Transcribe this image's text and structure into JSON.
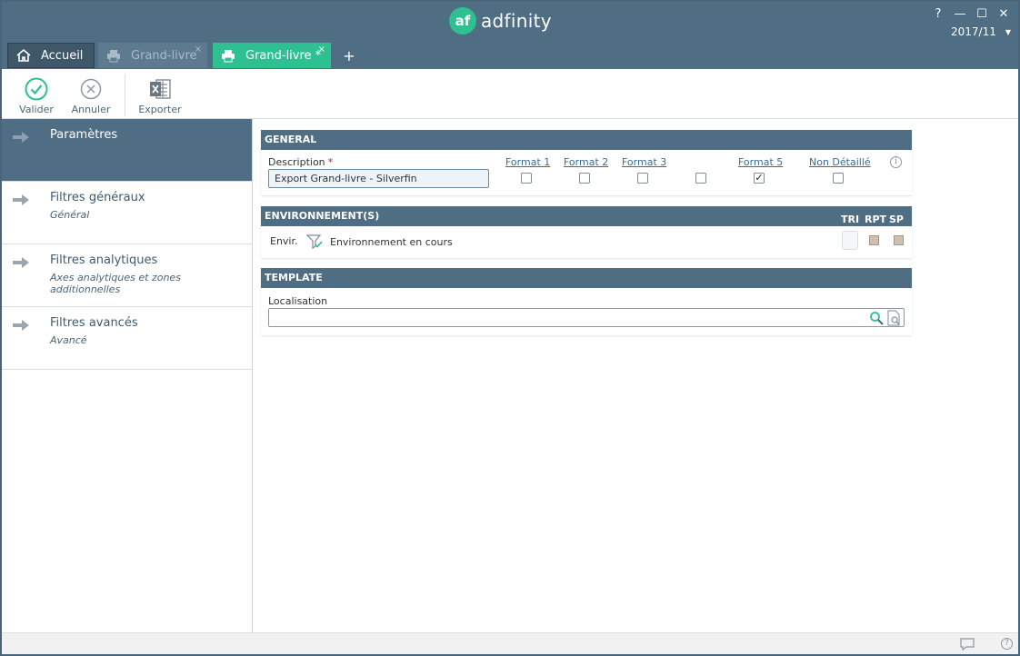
{
  "app": {
    "brand_mark": "af",
    "brand_name": "adfinity",
    "period": "2017/11",
    "window_controls": {
      "help": "?",
      "minimize": "—",
      "maximize": "☐",
      "close": "✕"
    }
  },
  "tabs": [
    {
      "label": "Accueil",
      "icon": "home-icon",
      "state": "normal"
    },
    {
      "label": "Grand-livre",
      "icon": "printer-icon",
      "state": "inactive",
      "close": "×"
    },
    {
      "label": "Grand-livre *",
      "icon": "printer-icon",
      "state": "active",
      "close": "×"
    }
  ],
  "tab_add": "+",
  "toolbar": {
    "valider": "Valider",
    "annuler": "Annuler",
    "exporter": "Exporter"
  },
  "sidenav": [
    {
      "label": "Paramètres",
      "sub": "",
      "active": true
    },
    {
      "label": "Filtres généraux",
      "sub": "Général",
      "active": false
    },
    {
      "label": "Filtres analytiques",
      "sub": "Axes analytiques et zones additionnelles",
      "active": false
    },
    {
      "label": "Filtres avancés",
      "sub": "Avancé",
      "active": false
    }
  ],
  "general": {
    "header": "GENERAL",
    "description_label": "Description",
    "required_mark": "*",
    "description_value": "Export Grand-livre - Silverfin",
    "formats": [
      {
        "label": "Format 1",
        "checked": false
      },
      {
        "label": "Format 2",
        "checked": false
      },
      {
        "label": "Format 3",
        "checked": false
      },
      {
        "label": "",
        "checked": false
      },
      {
        "label": "Format 5",
        "checked": true
      },
      {
        "label": "Non Détaillé",
        "checked": false
      }
    ],
    "info_icon": "i"
  },
  "environment": {
    "header": "ENVIRONNEMENT(S)",
    "col_tri": "TRI",
    "col_rpt": "RPT",
    "col_sp": "SP",
    "envir_label": "Envir.",
    "envir_value": "Environnement en cours"
  },
  "template": {
    "header": "TEMPLATE",
    "localisation_label": "Localisation",
    "localisation_value": ""
  },
  "statusbar": {
    "help": "?"
  },
  "colors": {
    "header_bg": "#4f6e84",
    "accent_green": "#2ec090",
    "tab_active": "#2ec090"
  }
}
